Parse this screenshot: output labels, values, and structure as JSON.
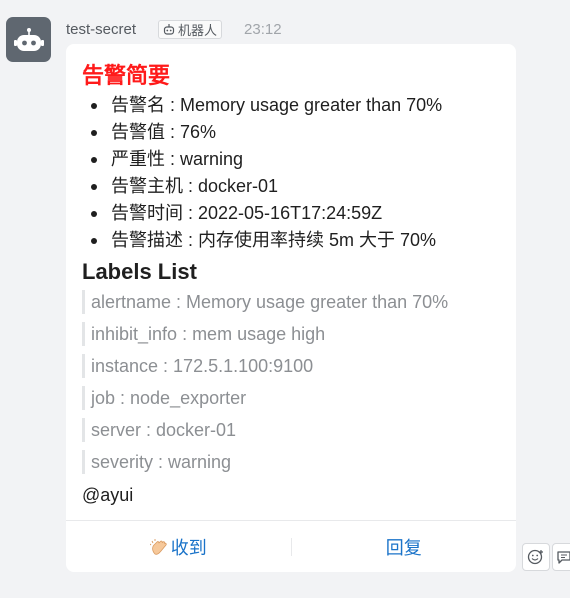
{
  "header": {
    "sender": "test-secret",
    "bot_badge": "机器人",
    "time": "23:12"
  },
  "card": {
    "alert_title": "告警简要",
    "summary": [
      "告警名 : Memory usage greater than 70%",
      "告警值 : 76%",
      "严重性 : warning",
      "告警主机 : docker-01",
      "告警时间 : 2022-05-16T17:24:59Z",
      "告警描述 : 内存使用率持续 5m 大于 70%"
    ],
    "labels_title": "Labels List",
    "labels": [
      "alertname : Memory usage greater than 70%",
      "inhibit_info : mem usage high",
      "instance : 172.5.1.100:9100",
      "job : node_exporter",
      "server : docker-01",
      "severity : warning"
    ],
    "mention": "@ayui"
  },
  "actions": {
    "ack_label": "收到",
    "reply_label": "回复"
  },
  "icons": {
    "avatar": "robot-icon",
    "badge": "robot-icon",
    "ack": "clap-hand-icon",
    "side_1": "emoji-reaction-icon",
    "side_2": "comment-icon"
  },
  "colors": {
    "alert_title": "#ff1a1a",
    "action_text": "#1a73c9",
    "label_text": "#8c8f93"
  }
}
